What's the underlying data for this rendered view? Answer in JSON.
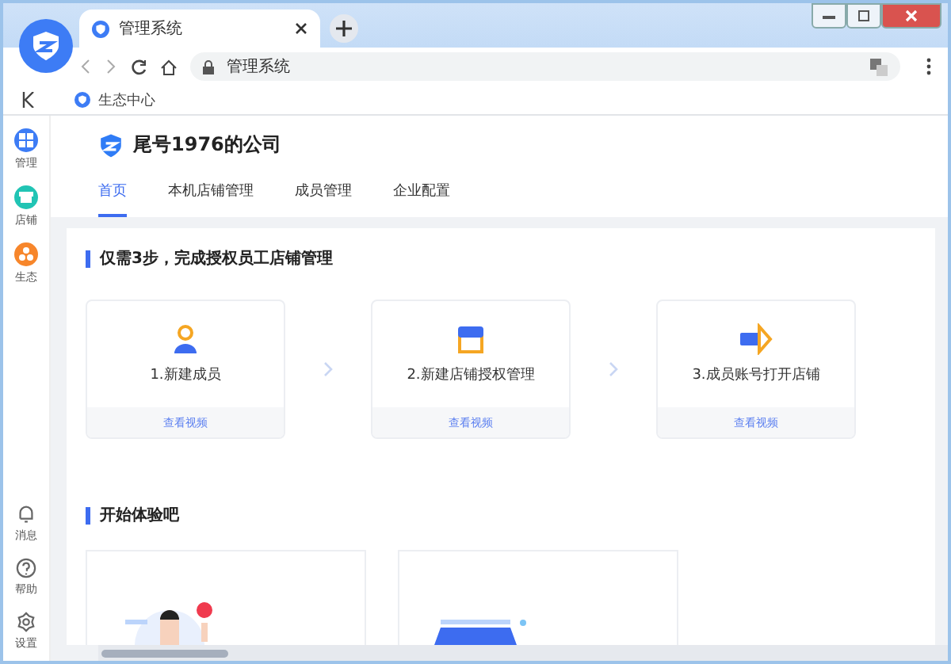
{
  "browser": {
    "tab_title": "管理系统",
    "address": "管理系统",
    "bookmarks": [
      {
        "label": "生态中心"
      }
    ]
  },
  "sidebar": {
    "top": [
      {
        "label": "管理",
        "kind": "grid",
        "color": "#3d7cf5"
      },
      {
        "label": "店铺",
        "kind": "store",
        "color": "#21c4b4"
      },
      {
        "label": "生态",
        "kind": "eco",
        "color": "#f7862b"
      }
    ],
    "bottom": [
      {
        "label": "消息",
        "kind": "bell"
      },
      {
        "label": "帮助",
        "kind": "help"
      },
      {
        "label": "设置",
        "kind": "gear"
      }
    ]
  },
  "company": {
    "name": "尾号1976的公司"
  },
  "nav_tabs": [
    {
      "label": "首页",
      "selected": true
    },
    {
      "label": "本机店铺管理",
      "selected": false
    },
    {
      "label": "成员管理",
      "selected": false
    },
    {
      "label": "企业配置",
      "selected": false
    }
  ],
  "steps_section": {
    "title": "仅需3步，完成授权员工店铺管理",
    "steps": [
      {
        "kind": "person",
        "label": "1.新建成员",
        "link": "查看视频"
      },
      {
        "kind": "store",
        "label": "2.新建店铺授权管理",
        "link": "查看视频"
      },
      {
        "kind": "open",
        "label": "3.成员账号打开店铺",
        "link": "查看视频"
      }
    ]
  },
  "try_section": {
    "title": "开始体验吧",
    "cards": [
      {
        "kind": "person"
      },
      {
        "kind": "laptop"
      }
    ]
  }
}
